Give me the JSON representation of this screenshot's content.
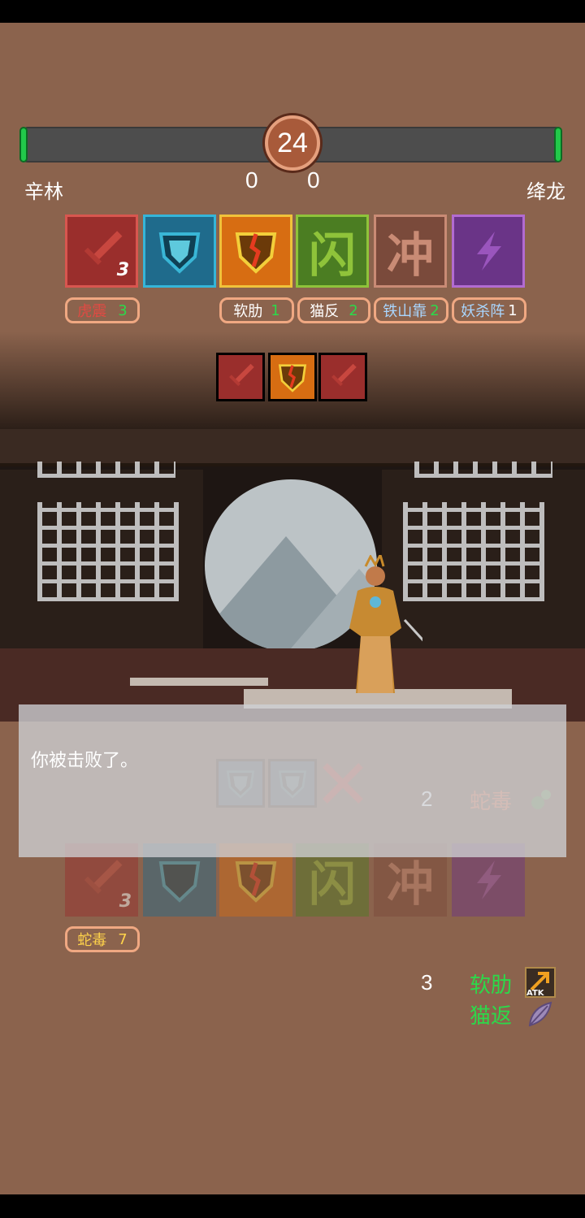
{
  "timer": "24",
  "player_left": {
    "name": "辛林",
    "score": "0"
  },
  "player_right": {
    "name": "绛龙",
    "score": "0"
  },
  "enemy_cards": [
    {
      "icon": "sword-icon",
      "count": "3",
      "color": "#9a2e2c"
    },
    {
      "icon": "shield-icon",
      "count": "",
      "color": "#1f6b8c"
    },
    {
      "icon": "broken-shield-icon",
      "count": "",
      "color": "#d76d12"
    },
    {
      "icon": "dodge-glyph",
      "glyph": "闪",
      "count": "",
      "color": "#4b7d22"
    },
    {
      "icon": "charge-glyph",
      "glyph": "冲",
      "count": "",
      "color": "#7a4a3b"
    },
    {
      "icon": "lightning-icon",
      "count": "",
      "color": "#6a3487"
    }
  ],
  "enemy_tags": [
    {
      "name": "虎震",
      "value": "3",
      "name_color": "#e14a43",
      "value_color": "#2cd94a"
    },
    {
      "name": "软肋",
      "value": "1",
      "name_color": "#ffffff",
      "value_color": "#2cd94a"
    },
    {
      "name": "猫反",
      "value": "2",
      "name_color": "#ffffff",
      "value_color": "#2cd94a"
    },
    {
      "name": "铁山靠",
      "value": "2",
      "name_color": "#a9d6ff",
      "value_color": "#2cd94a"
    },
    {
      "name": "妖杀阵",
      "value": "1",
      "name_color": "#a9d6ff",
      "value_color": "#ffffff"
    }
  ],
  "enemy_sequence": [
    "sword-icon",
    "broken-shield-icon",
    "sword-icon"
  ],
  "player_sequence": [
    "shield-icon",
    "shield-icon",
    "cross-icon"
  ],
  "player_effect": {
    "value": "2",
    "name": "蛇毒",
    "icon": "poison-icon"
  },
  "message": "你被击败了。",
  "player_cards": [
    {
      "icon": "sword-icon",
      "count": "3"
    },
    {
      "icon": "shield-icon",
      "count": ""
    },
    {
      "icon": "broken-shield-icon",
      "count": ""
    },
    {
      "icon": "dodge-glyph",
      "glyph": "闪",
      "count": ""
    },
    {
      "icon": "charge-glyph",
      "glyph": "冲",
      "count": ""
    },
    {
      "icon": "lightning-icon",
      "count": ""
    }
  ],
  "player_tags": [
    {
      "name": "蛇毒",
      "value": "7"
    }
  ],
  "bottom_effects": {
    "value": "3",
    "items": [
      {
        "name": "软肋",
        "icon": "atk-up-icon",
        "icon_text": "ATK"
      },
      {
        "name": "猫返",
        "icon": "feather-icon"
      }
    ]
  }
}
